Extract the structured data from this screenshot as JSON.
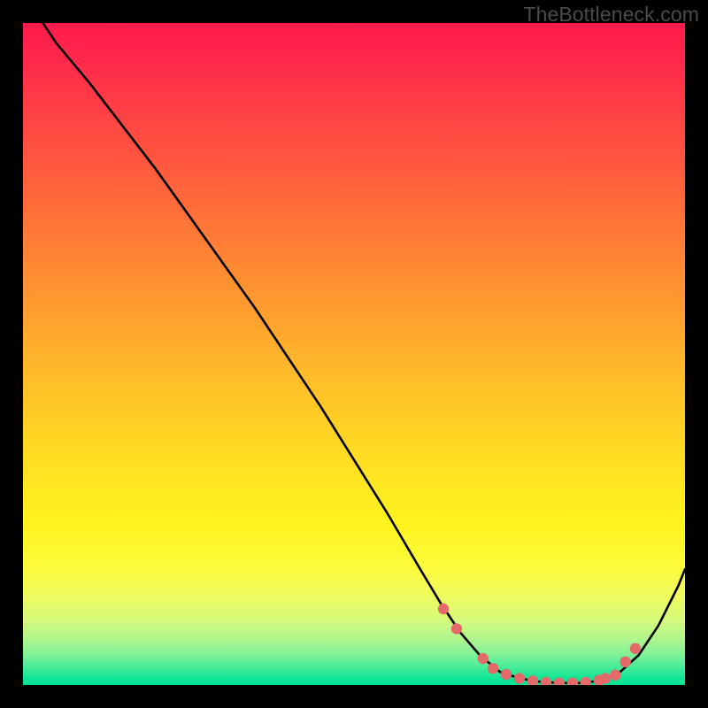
{
  "watermark": "TheBottleneck.com",
  "chart_data": {
    "type": "line",
    "title": "",
    "xlabel": "",
    "ylabel": "",
    "xlim": [
      0,
      100
    ],
    "ylim": [
      0,
      100
    ],
    "note": "Bottleneck curve: y is bottleneck percentage (0 at bottom/green, 100 at top/red). The curve descends steeply from top-left, flattens near x≈70–88 at y≈0, then rises again toward the right edge.",
    "series": [
      {
        "name": "bottleneck-curve",
        "x": [
          3,
          5,
          10,
          15,
          20,
          25,
          30,
          35,
          40,
          45,
          50,
          55,
          60,
          63,
          66,
          69,
          72,
          75,
          78,
          81,
          84,
          87,
          90,
          93,
          96,
          99,
          100
        ],
        "y": [
          100,
          97,
          91,
          84.5,
          78,
          71,
          64,
          57,
          49.5,
          42,
          34,
          26,
          17.5,
          12.5,
          8,
          4.5,
          2,
          1,
          0.5,
          0.3,
          0.3,
          0.6,
          1.8,
          4.5,
          9,
          15,
          17.5
        ]
      }
    ],
    "markers": {
      "name": "highlight-dots",
      "color": "#e46a6a",
      "points": [
        {
          "x": 63.5,
          "y": 11.5
        },
        {
          "x": 65.5,
          "y": 8.5
        },
        {
          "x": 69.5,
          "y": 4.0
        },
        {
          "x": 71.0,
          "y": 2.5
        },
        {
          "x": 73.0,
          "y": 1.6
        },
        {
          "x": 75.0,
          "y": 1.0
        },
        {
          "x": 77.0,
          "y": 0.6
        },
        {
          "x": 79.0,
          "y": 0.4
        },
        {
          "x": 81.0,
          "y": 0.3
        },
        {
          "x": 83.0,
          "y": 0.3
        },
        {
          "x": 85.0,
          "y": 0.4
        },
        {
          "x": 87.0,
          "y": 0.7
        },
        {
          "x": 88.0,
          "y": 1.0
        },
        {
          "x": 89.5,
          "y": 1.5
        },
        {
          "x": 91.0,
          "y": 3.5
        },
        {
          "x": 92.5,
          "y": 5.5
        }
      ]
    }
  }
}
